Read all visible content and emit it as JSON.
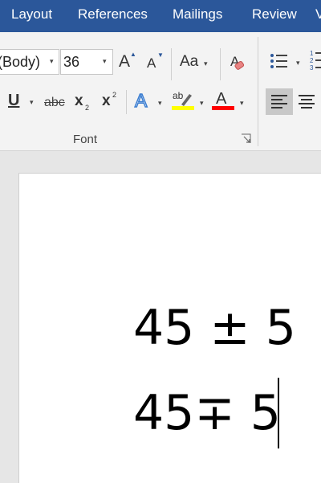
{
  "menu": {
    "tabs": [
      "Layout",
      "References",
      "Mailings",
      "Review",
      "V"
    ]
  },
  "ribbon": {
    "font_name": "(Body)",
    "font_size": "36",
    "grow_font_label": "A",
    "shrink_font_label": "A",
    "change_case_label": "Aa",
    "underline_label": "U",
    "strikethrough_label": "abc",
    "subscript_label": "x",
    "subscript_small": "2",
    "superscript_label": "x",
    "superscript_small": "2",
    "text_effects_label": "A",
    "highlight_label": "ab",
    "font_color_label": "A",
    "font_group_label": "Font",
    "numbering_labels": [
      "1",
      "2",
      "3"
    ]
  },
  "colors": {
    "menubar": "#2b579a",
    "highlight": "#ffff00",
    "font_color": "#ff0000",
    "text_effects": "#3c7ed1"
  },
  "document": {
    "line1": "45 ± 5",
    "line2": "45∓ 5"
  }
}
